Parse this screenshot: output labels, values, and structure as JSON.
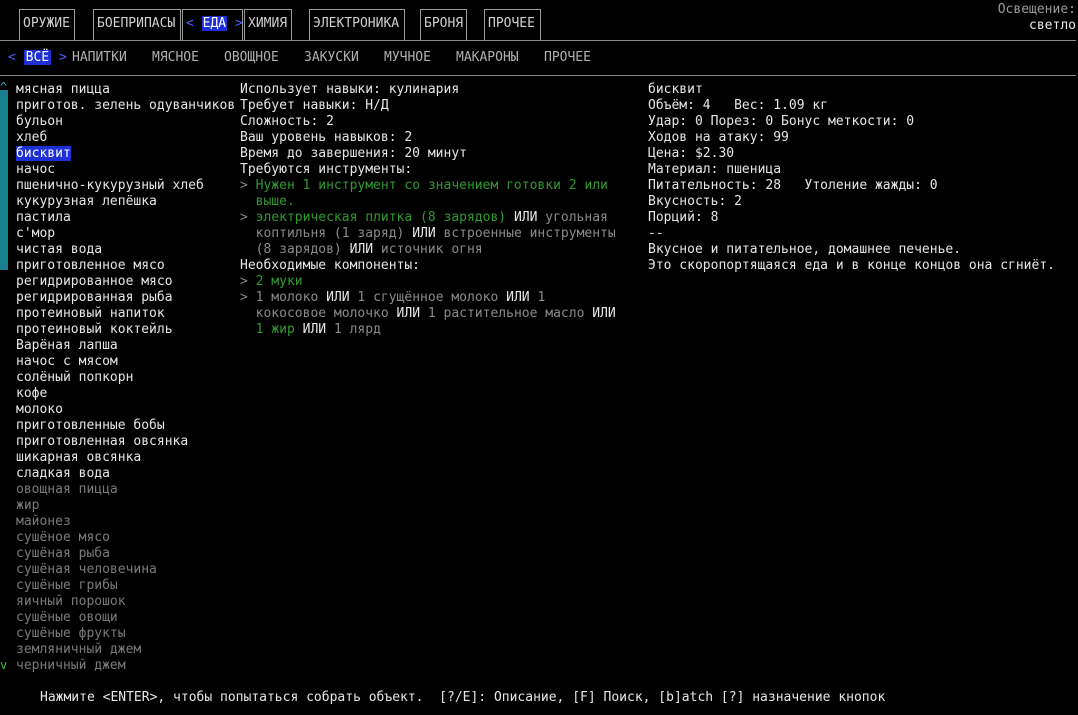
{
  "top_tabs": [
    {
      "label": "ОРУЖИЕ"
    },
    {
      "label": "БОЕПРИПАСЫ"
    },
    {
      "label": "ЕДА",
      "active": true
    },
    {
      "label": "ХИМИЯ"
    },
    {
      "label": "ЭЛЕКТРОНИКА"
    },
    {
      "label": "БРОНЯ"
    },
    {
      "label": "ПРОЧЕЕ"
    }
  ],
  "lighting": {
    "label": "Освещение:",
    "value": "светло"
  },
  "sub_tabs": [
    {
      "label": "ВСЁ",
      "active": true
    },
    {
      "label": "НАПИТКИ"
    },
    {
      "label": "МЯСНОЕ"
    },
    {
      "label": "ОВОЩНОЕ"
    },
    {
      "label": "ЗАКУСКИ"
    },
    {
      "label": "МУЧНОЕ"
    },
    {
      "label": "МАКАРОНЫ"
    },
    {
      "label": "ПРОЧЕЕ"
    }
  ],
  "recipes": [
    {
      "name": "мясная пицца"
    },
    {
      "name": "приготов. зелень одуванчиков"
    },
    {
      "name": "бульон"
    },
    {
      "name": "хлеб"
    },
    {
      "name": "бисквит",
      "selected": true
    },
    {
      "name": "начос"
    },
    {
      "name": "пшенично-кукурузный хлеб"
    },
    {
      "name": "кукурузная лепёшка"
    },
    {
      "name": "пастила"
    },
    {
      "name": "с'мор"
    },
    {
      "name": "чистая вода"
    },
    {
      "name": "приготовленное мясо"
    },
    {
      "name": "регидрированное мясо"
    },
    {
      "name": "регидрированная рыба"
    },
    {
      "name": "протеиновый напиток"
    },
    {
      "name": "протеиновый коктейль"
    },
    {
      "name": "Варёная лапша"
    },
    {
      "name": "начос с мясом"
    },
    {
      "name": "солёный попкорн"
    },
    {
      "name": "кофе"
    },
    {
      "name": "молоко"
    },
    {
      "name": "приготовленные бобы"
    },
    {
      "name": "приготовленная овсянка"
    },
    {
      "name": "шикарная овсянка"
    },
    {
      "name": "сладкая вода"
    },
    {
      "name": "овощная пицца",
      "dim": true
    },
    {
      "name": "жир",
      "dim": true
    },
    {
      "name": "майонез",
      "dim": true
    },
    {
      "name": "сушёное мясо",
      "dim": true
    },
    {
      "name": "сушёная рыба",
      "dim": true
    },
    {
      "name": "сушёная человечина",
      "dim": true
    },
    {
      "name": "сушёные грибы",
      "dim": true
    },
    {
      "name": "яичный порошок",
      "dim": true
    },
    {
      "name": "сушёные овощи",
      "dim": true
    },
    {
      "name": "сушёные фрукты",
      "dim": true
    },
    {
      "name": "земляничный джем",
      "dim": true
    },
    {
      "name": "черничный джем",
      "dim": true
    }
  ],
  "details": {
    "uses_skill": "Использует навыки: кулинария",
    "requires_skill": "Требует навыки: Н/Д",
    "difficulty": "Сложность: 2",
    "your_skill": "Ваш уровень навыков: 2",
    "time": "Время до завершения: 20 минут",
    "tools_header": "Требуются инструменты:",
    "tool1_a": "Нужен 1 инструмент со значением готовки 2 или",
    "tool1_b": "выше.",
    "tool2_a1": "электрическая плитка (8 зарядов)",
    "tool2_a2": "ИЛИ",
    "tool2_a3": "угольная",
    "tool2_b1": "коптильня (1 заряд)",
    "tool2_b2": "ИЛИ",
    "tool2_b3": "встроенные инструменты",
    "tool2_c1": "(8 зарядов)",
    "tool2_c2": "ИЛИ",
    "tool2_c3": "источник огня",
    "components_header": "Необходимые компоненты:",
    "comp1": "2 муки",
    "comp2_a": "1 молоко",
    "comp2_or1": "ИЛИ",
    "comp2_b": "1 сгущённое молоко",
    "comp2_or2": "ИЛИ",
    "comp2_c": "1",
    "comp2_d": "кокосовое молочко",
    "comp2_or3": "ИЛИ",
    "comp2_e": "1",
    "comp2_f": "растительное масло",
    "comp2_or4": "ИЛИ",
    "comp2_g": "1 жир",
    "comp2_or5": "ИЛИ",
    "comp2_h": "1 лярд"
  },
  "item": {
    "name": "бисквит",
    "volume_weight": "Объём: 4   Вес: 1.09 кг",
    "bash_cut": "Удар: 0 Порез: 0 Бонус меткости: 0",
    "moves": "Ходов на атаку: 99",
    "price": "Цена: $2.30",
    "material": "Материал: пшеница",
    "nutrition": "Питательность: 28   Утоление жажды: 0",
    "taste": "Вкусность: 2",
    "portions": "Порций: 8",
    "sep": "--",
    "desc1": "Вкусное и питательное, домашнее печенье.",
    "desc2": "Это скоропортящаяся еда и в конце концов она сгниёт."
  },
  "footer": "Нажмите <ENTER>, чтобы попытаться собрать объект.  [?/E]: Описание, [F] Поиск, [b]atch [?] назначение кнопок"
}
